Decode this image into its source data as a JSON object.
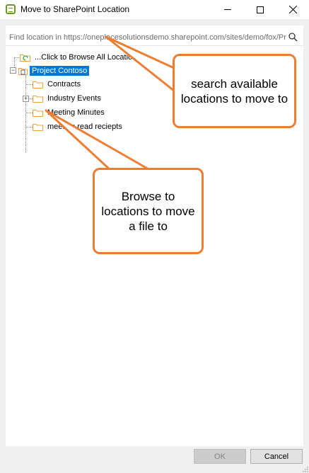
{
  "window": {
    "title": "Move to SharePoint Location",
    "icon": "sharepoint-plugin-icon",
    "controls": [
      "minimize",
      "maximize",
      "close"
    ]
  },
  "search": {
    "placeholder": "Find location in https://oneplacesolutionsdemo.sharepoint.com/sites/demo/fox/Pro",
    "icon": "search-icon"
  },
  "tree": {
    "browse_all_label": "...Click to Browse All Locations",
    "root_label": "Project Contoso",
    "children": [
      {
        "label": "Contracts",
        "expandable": false
      },
      {
        "label": "Industry Events",
        "expandable": true
      },
      {
        "label": "Meeting Minutes",
        "expandable": false
      },
      {
        "label": "meeting read reciepts",
        "expandable": false
      }
    ]
  },
  "callouts": {
    "search_tip": "search available locations to move to",
    "browse_tip": "Browse to locations to move a file to"
  },
  "buttons": {
    "ok": "OK",
    "cancel": "Cancel"
  },
  "colors": {
    "accent_orange": "#ed7d31",
    "selection_blue": "#0078d7",
    "folder_orange": "#e8a33d"
  }
}
